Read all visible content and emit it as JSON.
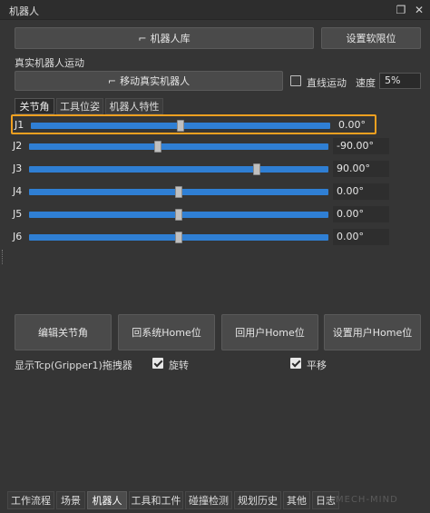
{
  "window": {
    "title": "机器人"
  },
  "top_buttons": {
    "robot_library": "机器人库",
    "set_soft_limits": "设置软限位"
  },
  "real_robot": {
    "section_label": "真实机器人运动",
    "move_button": "移动真实机器人",
    "linear_motion_label": "直线运动",
    "linear_motion_checked": false,
    "speed_label": "速度",
    "speed_value": "5%"
  },
  "tabs": [
    {
      "label": "关节角",
      "active": true
    },
    {
      "label": "工具位姿",
      "active": false
    },
    {
      "label": "机器人特性",
      "active": false
    }
  ],
  "joints": [
    {
      "name": "J1",
      "value": "0.00°",
      "fraction": 0.5,
      "selected": true
    },
    {
      "name": "J2",
      "value": "-90.00°",
      "fraction": 0.43,
      "selected": false
    },
    {
      "name": "J3",
      "value": "90.00°",
      "fraction": 0.76,
      "selected": false
    },
    {
      "name": "J4",
      "value": "0.00°",
      "fraction": 0.5,
      "selected": false
    },
    {
      "name": "J5",
      "value": "0.00°",
      "fraction": 0.5,
      "selected": false
    },
    {
      "name": "J6",
      "value": "0.00°",
      "fraction": 0.5,
      "selected": false
    }
  ],
  "action_buttons": {
    "edit_joints": "编辑关节角",
    "return_system_home": "回系统Home位",
    "return_user_home": "回用户Home位",
    "set_user_home": "设置用户Home位"
  },
  "tcp": {
    "label": "显示Tcp(Gripper1)拖拽器",
    "rotate_label": "旋转",
    "rotate_checked": true,
    "translate_label": "平移",
    "translate_checked": true
  },
  "bottom_tabs": [
    {
      "label": "工作流程",
      "active": false
    },
    {
      "label": "场景",
      "active": false
    },
    {
      "label": "机器人",
      "active": true
    },
    {
      "label": "工具和工件",
      "active": false
    },
    {
      "label": "碰撞检测",
      "active": false
    },
    {
      "label": "规划历史",
      "active": false
    },
    {
      "label": "其他",
      "active": false
    },
    {
      "label": "日志",
      "active": false
    }
  ],
  "watermark": "MECH-MIND",
  "colors": {
    "accent": "#2f7fd4",
    "selection": "#f0a020",
    "background": "#353535"
  }
}
